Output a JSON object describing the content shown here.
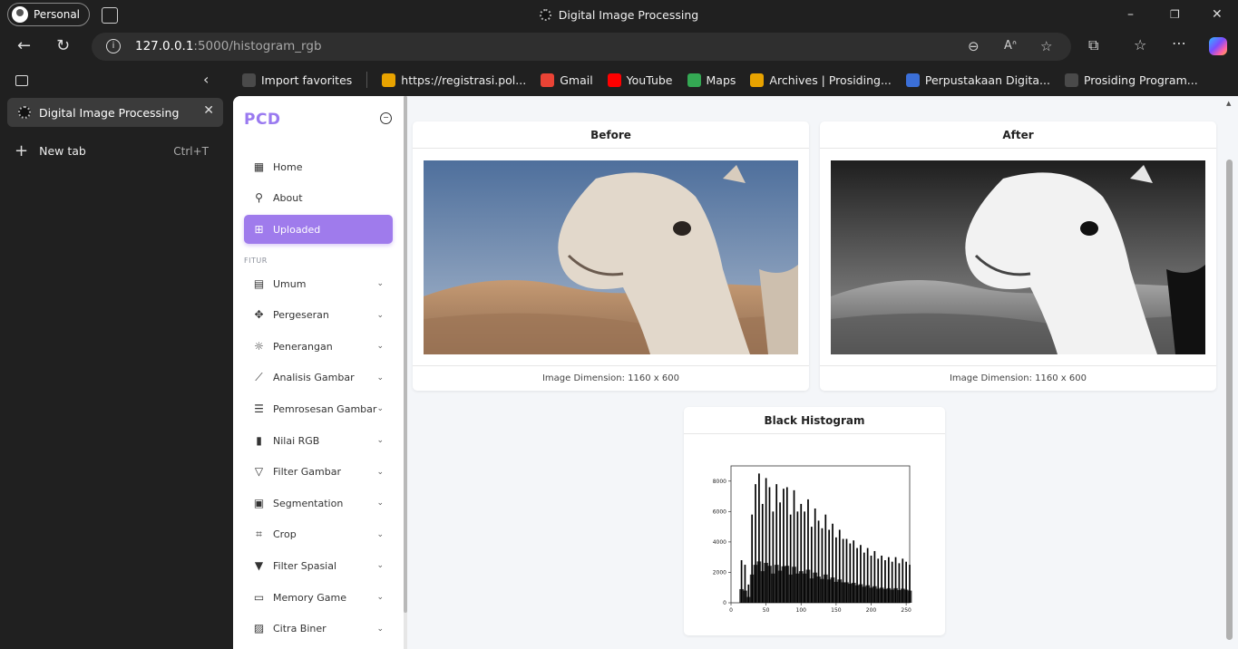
{
  "window": {
    "profile_label": "Personal",
    "title": "Digital Image Processing",
    "minimize": "–",
    "restore": "❐",
    "close": "✕"
  },
  "address_bar": {
    "url_host": "127.0.0.1",
    "url_rest": ":5000/histogram_rgb"
  },
  "favorites": [
    {
      "label": "Import favorites",
      "icon": "import-icon",
      "color": "#4a4a4a"
    },
    {
      "label": "https://registrasi.pol...",
      "icon": "polinema-icon",
      "color": "#e8a300"
    },
    {
      "label": "Gmail",
      "icon": "gmail-icon",
      "color": "#ea4335"
    },
    {
      "label": "YouTube",
      "icon": "youtube-icon",
      "color": "#ff0000"
    },
    {
      "label": "Maps",
      "icon": "maps-icon",
      "color": "#34a853"
    },
    {
      "label": "Archives | Prosiding...",
      "icon": "polinema-icon",
      "color": "#e8a300"
    },
    {
      "label": "Perpustakaan Digita...",
      "icon": "library-icon",
      "color": "#3b6fd8"
    },
    {
      "label": "Prosiding Program...",
      "icon": "globe-icon",
      "color": "#4a4a4a"
    }
  ],
  "vertical_tabs": {
    "active_tab": "Digital Image Processing",
    "new_tab_label": "New tab",
    "new_tab_shortcut": "Ctrl+T"
  },
  "app": {
    "brand": "PCD",
    "section_label": "FITUR",
    "top_menu": [
      {
        "label": "Home",
        "icon": "grid-icon"
      },
      {
        "label": "About",
        "icon": "user-icon"
      },
      {
        "label": "Uploaded",
        "icon": "upload-icon",
        "active": true
      }
    ],
    "feature_menu": [
      {
        "label": "Umum",
        "icon": "document-icon"
      },
      {
        "label": "Pergeseran",
        "icon": "move-icon"
      },
      {
        "label": "Penerangan",
        "icon": "sun-icon"
      },
      {
        "label": "Analisis Gambar",
        "icon": "line-chart-icon"
      },
      {
        "label": "Pemrosesan Gambar",
        "icon": "sliders-icon"
      },
      {
        "label": "Nilai RGB",
        "icon": "bar-chart-icon"
      },
      {
        "label": "Filter Gambar",
        "icon": "filter-icon"
      },
      {
        "label": "Segmentation",
        "icon": "segment-icon"
      },
      {
        "label": "Crop",
        "icon": "crop-icon"
      },
      {
        "label": "Filter Spasial",
        "icon": "funnel-icon"
      },
      {
        "label": "Memory Game",
        "icon": "gamepad-icon"
      },
      {
        "label": "Citra Biner",
        "icon": "image-icon"
      }
    ]
  },
  "cards": {
    "before": {
      "title": "Before",
      "footer": "Image Dimension: 1160 x 600"
    },
    "after": {
      "title": "After",
      "footer": "Image Dimension: 1160 x 600"
    },
    "histogram": {
      "title": "Black Histogram"
    }
  },
  "chart_data": {
    "type": "bar",
    "title": "",
    "xlabel": "",
    "ylabel": "",
    "xlim": [
      0,
      255
    ],
    "ylim": [
      0,
      9000
    ],
    "x_ticks": [
      0,
      50,
      100,
      150,
      200,
      250
    ],
    "y_ticks": [
      0,
      2000,
      4000,
      6000,
      8000
    ],
    "x": [
      0,
      5,
      10,
      15,
      20,
      25,
      30,
      35,
      40,
      45,
      50,
      55,
      60,
      65,
      70,
      75,
      80,
      85,
      90,
      95,
      100,
      105,
      110,
      115,
      120,
      125,
      130,
      135,
      140,
      145,
      150,
      155,
      160,
      165,
      170,
      175,
      180,
      185,
      190,
      195,
      200,
      205,
      210,
      215,
      220,
      225,
      230,
      235,
      240,
      245,
      250,
      255
    ],
    "values": [
      0,
      0,
      0,
      2800,
      2500,
      1200,
      5800,
      7800,
      8500,
      6500,
      8200,
      7600,
      6000,
      7800,
      6600,
      7500,
      7600,
      5800,
      7400,
      6000,
      6500,
      6000,
      6800,
      5000,
      6200,
      5400,
      4900,
      5800,
      4800,
      5200,
      4300,
      4800,
      4200,
      4200,
      3900,
      4100,
      3600,
      3800,
      3300,
      3600,
      3100,
      3400,
      2900,
      3100,
      2800,
      3000,
      2700,
      3000,
      2600,
      2900,
      2700,
      2500
    ],
    "grid": false,
    "color": "#000000"
  }
}
